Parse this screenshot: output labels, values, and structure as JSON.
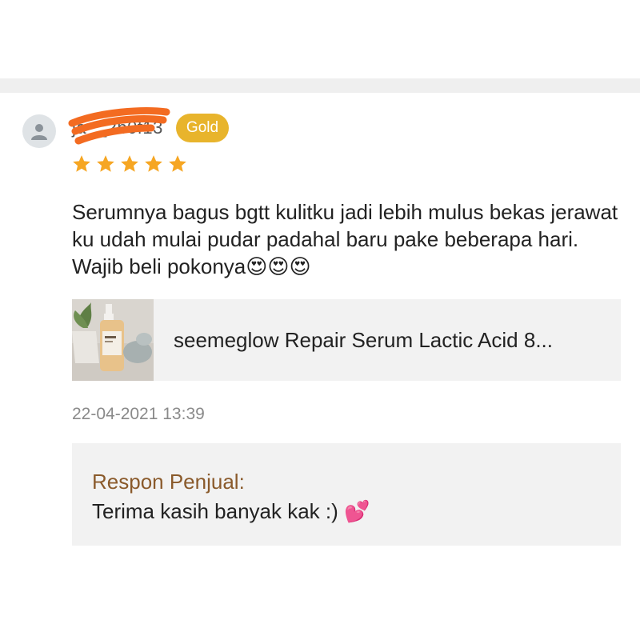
{
  "review": {
    "username": "ja__2b0f13",
    "badge": "Gold",
    "rating": 5,
    "text": "Serumnya bagus bgtt kulitku jadi lebih mulus bekas jerawat ku udah mulai pudar padahal baru pake beberapa hari. Wajib beli pokonya😍😍😍",
    "timestamp": "22-04-2021 13:39"
  },
  "product": {
    "name": "seemeglow Repair Serum Lactic Acid 8..."
  },
  "seller_response": {
    "title": "Respon Penjual:",
    "text": "Terima kasih banyak kak :) 💕"
  },
  "colors": {
    "badge": "#e8b42c",
    "star": "#f6a623",
    "seller_title": "#8a5a2b",
    "scribble": "#f36b21"
  },
  "icons": {
    "avatar": "user-silhouette-icon",
    "star": "star-icon"
  }
}
